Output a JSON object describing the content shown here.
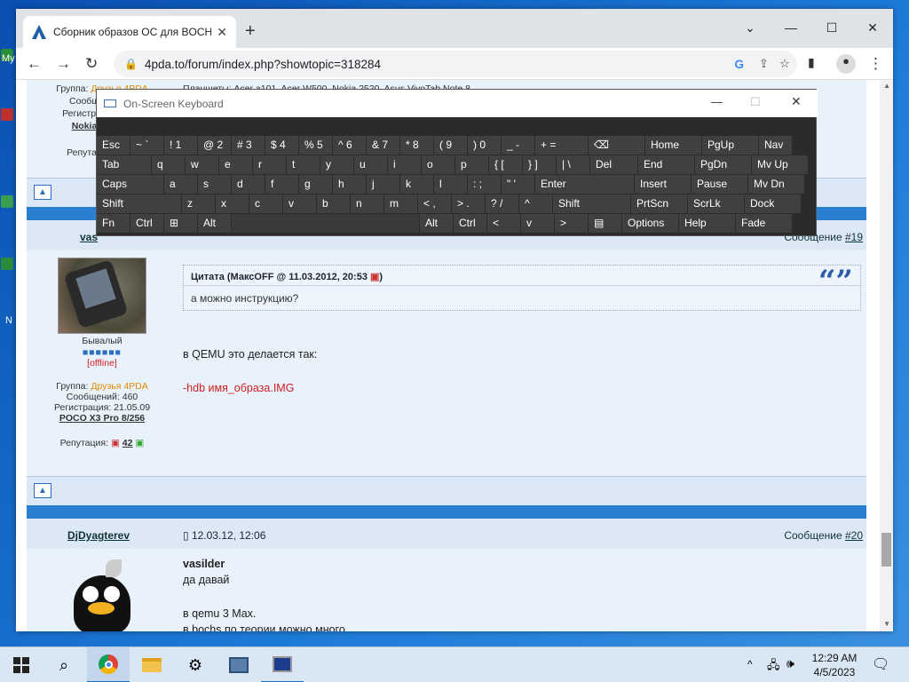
{
  "desktop": {
    "icon_labels": [
      "My",
      "N"
    ]
  },
  "browser": {
    "tab_title": "Сборник образов ОС для BOCHS",
    "url": "4pda.to/forum/index.php?showtopic=318284"
  },
  "post1": {
    "group_label": "Группа:",
    "group_value": "Друзья 4PDA",
    "messages_label": "Сообщ",
    "reg_label": "Регистрац",
    "device": "Nokia",
    "reputation": "Репутац",
    "tablets": "Планшеты: Acer a101, Acer W500, Nokia 2520, Asus VivoTab Note 8"
  },
  "post2": {
    "author_partial": "vas",
    "msg_link": "#19",
    "msg_prefix": "Сообщение",
    "rank": "Бывалый",
    "status": "[offline]",
    "group_label": "Группа:",
    "group_value": "Друзья 4PDA",
    "messages": "Сообщений: 460",
    "registered": "Регистрация: 21.05.09",
    "device": "POCO X3 Pro 8/256",
    "reputation_label": "Репутация:",
    "reputation_value": "42",
    "quote_header": "Цитата (МаксOFF @ 11.03.2012, 20:53",
    "quote_text": "а можно инструкцию?",
    "text1": "в QEMU это делается так:",
    "text2": "-hdb имя_образа.IMG"
  },
  "post3": {
    "author": "DjDyagterev",
    "date": "12.03.12, 12:06",
    "msg_prefix": "Сообщение",
    "msg_link": "#20",
    "bold_name": "vasilder",
    "line1": "да давай",
    "line2": "в qemu 3 Max.",
    "line3": "в bochs по теории можно много"
  },
  "osk": {
    "title": "On-Screen Keyboard",
    "rows": [
      [
        "Esc",
        "~ `",
        "! 1",
        "@ 2",
        "# 3",
        "$ 4",
        "% 5",
        "^ 6",
        "& 7",
        "* 8",
        "( 9",
        ") 0",
        "_ -",
        "+ =",
        "⌫",
        "Home",
        "PgUp",
        "Nav"
      ],
      [
        "Tab",
        "q",
        "w",
        "e",
        "r",
        "t",
        "y",
        "u",
        "i",
        "o",
        "p",
        "{ [",
        "} ]",
        "| \\",
        "Del",
        "End",
        "PgDn",
        "Mv Up"
      ],
      [
        "Caps",
        "a",
        "s",
        "d",
        "f",
        "g",
        "h",
        "j",
        "k",
        "l",
        ": ;",
        "\" '",
        "Enter",
        "Insert",
        "Pause",
        "Mv Dn"
      ],
      [
        "Shift",
        "z",
        "x",
        "c",
        "v",
        "b",
        "n",
        "m",
        "< ,",
        "> .",
        "? /",
        "^",
        "Shift",
        "PrtScn",
        "ScrLk",
        "Dock"
      ],
      [
        "Fn",
        "Ctrl",
        "⊞",
        "Alt",
        "",
        "Alt",
        "Ctrl",
        "<",
        "v",
        ">",
        "▤",
        "Options",
        "Help",
        "Fade"
      ]
    ]
  },
  "taskbar": {
    "time": "12:29 AM",
    "date": "4/5/2023"
  }
}
